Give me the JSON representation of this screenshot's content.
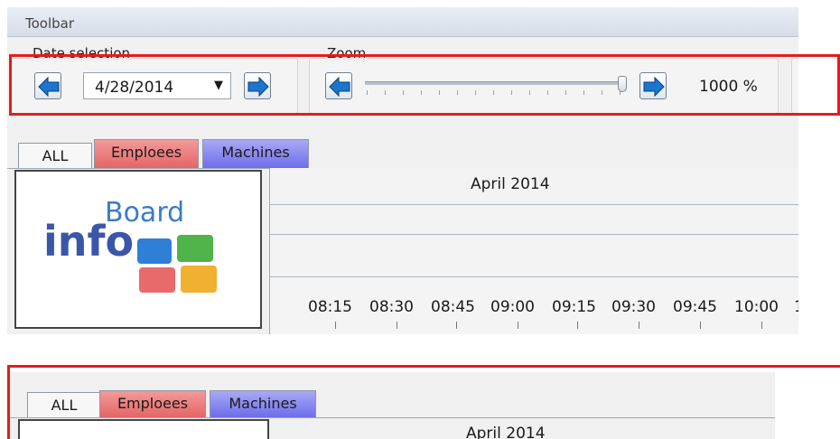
{
  "toolbar": {
    "title": "Toolbar",
    "date_group_label": "Date selection",
    "date_value": "4/28/2014",
    "zoom_group_label": "Zoom",
    "zoom_value": "1000 %",
    "zoom_level_percent": 100
  },
  "tabs": [
    {
      "label": "ALL",
      "color": "#f7f7f7"
    },
    {
      "label": "Emploees",
      "color": "#e56565"
    },
    {
      "label": "Machines",
      "color": "#6d6dea"
    }
  ],
  "logo": {
    "text_small": "Board",
    "text_large": "info"
  },
  "calendar": {
    "month": "April 2014",
    "hours": [
      "08:15",
      "08:30",
      "08:45",
      "09:00",
      "09:15",
      "09:30",
      "09:45",
      "10:00",
      "1("
    ]
  },
  "bottom": {
    "tabs": [
      "ALL",
      "Emploees",
      "Machines"
    ],
    "month_partial": "April 2014"
  },
  "colors": {
    "highlight_frame": "#e41c1c",
    "arrow_blue": "#1b76d0"
  }
}
